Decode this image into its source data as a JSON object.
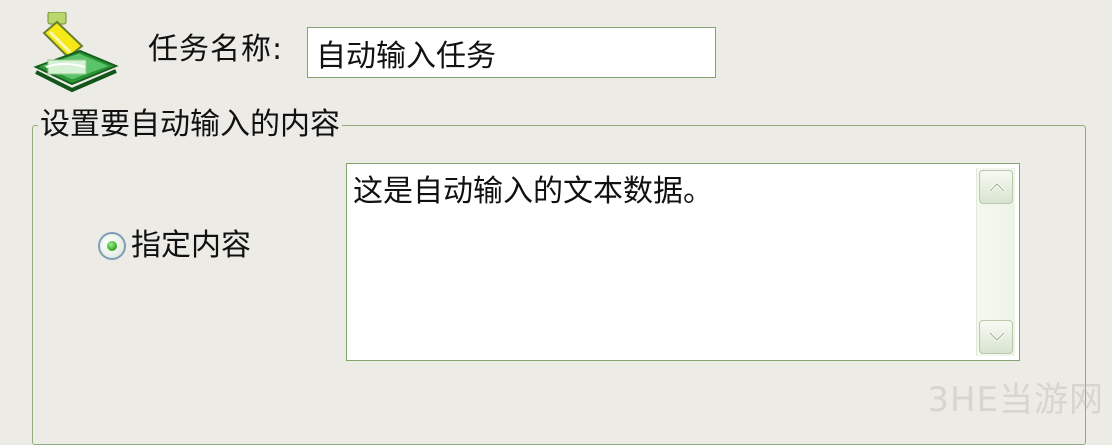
{
  "task": {
    "icon": "task-usb-paper-icon",
    "label": "任务名称:",
    "name_value": "自动输入任务"
  },
  "content_group": {
    "title": "设置要自动输入的内容",
    "radio_option": {
      "label": "指定内容",
      "checked": true
    },
    "text_value": "这是自动输入的文本数据。"
  },
  "scrollbar": {
    "up_icon": "chevron-up-icon",
    "down_icon": "chevron-down-icon"
  },
  "watermark": {
    "brand": "3HE当游网"
  },
  "colors": {
    "background": "#ecebe5",
    "border_green": "#82a56f",
    "radio_green": "#3dae2b"
  }
}
